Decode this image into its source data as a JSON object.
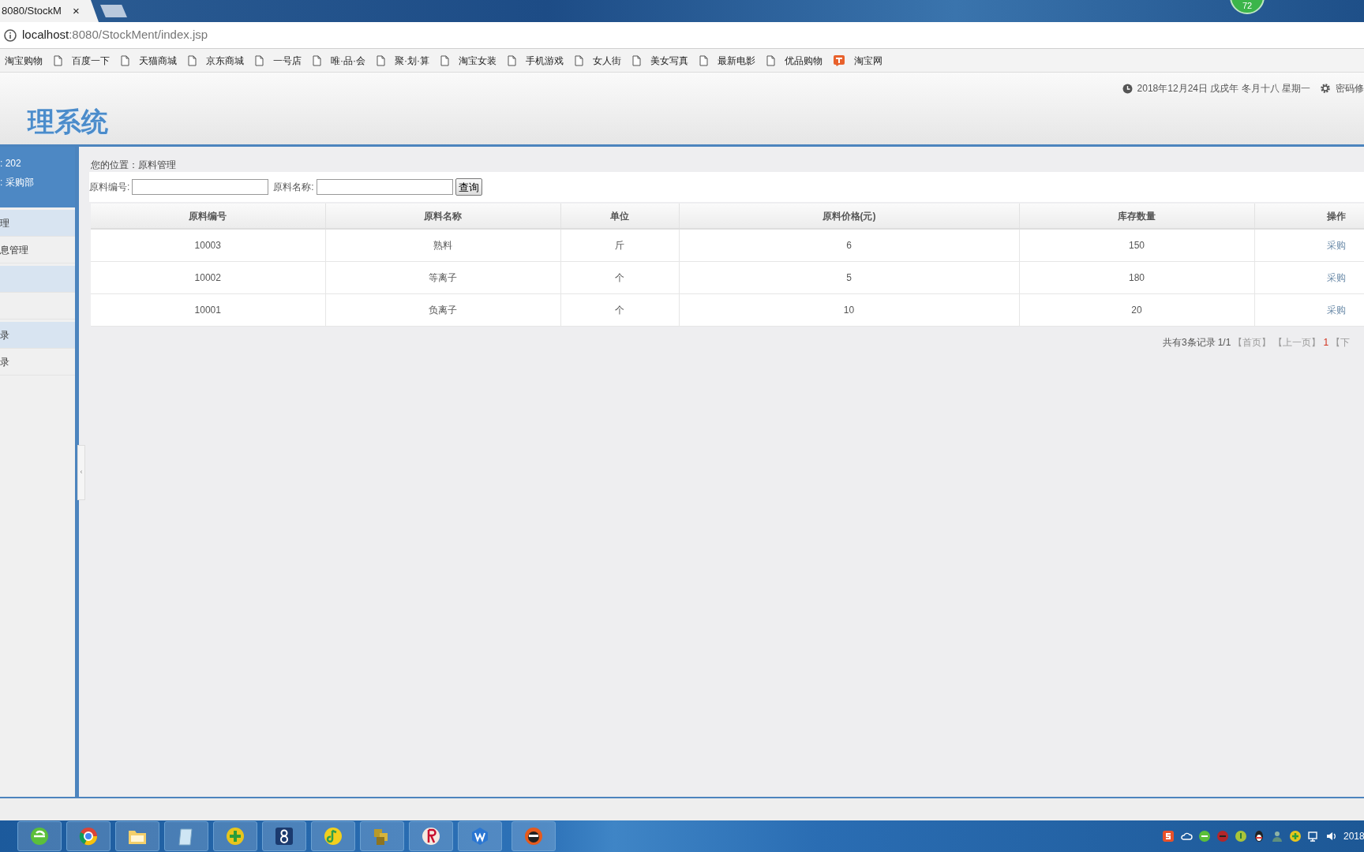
{
  "browser": {
    "tab_title": "8080/StockM",
    "tab_close": "×",
    "address": "localhost:8080/StockMent/index.jsp",
    "bookmarks": [
      {
        "label": "淘宝购物",
        "kind": "plain"
      },
      {
        "label": "百度一下",
        "kind": "page"
      },
      {
        "label": "天猫商城",
        "kind": "page"
      },
      {
        "label": "京东商城",
        "kind": "page"
      },
      {
        "label": "一号店",
        "kind": "page"
      },
      {
        "label": "唯·品·会",
        "kind": "page"
      },
      {
        "label": "聚·划·算",
        "kind": "page"
      },
      {
        "label": "淘宝女装",
        "kind": "page"
      },
      {
        "label": "手机游戏",
        "kind": "page"
      },
      {
        "label": "女人街",
        "kind": "page"
      },
      {
        "label": "美女写真",
        "kind": "page"
      },
      {
        "label": "最新电影",
        "kind": "page"
      },
      {
        "label": "优品购物",
        "kind": "page"
      },
      {
        "label": "淘宝网",
        "kind": "taobao"
      }
    ]
  },
  "desktop_badge": "72",
  "collapse_handle": "‹",
  "header": {
    "title": "理系统",
    "date": "2018年12月24日 戊戌年 冬月十八 星期一",
    "password_link": "密码修"
  },
  "user_info": [
    ": 202",
    ": 采购部"
  ],
  "sidebar": {
    "items": [
      {
        "label": "理",
        "kind": "group"
      },
      {
        "label": "息管理",
        "kind": "item"
      },
      {
        "kind": "group"
      },
      {
        "kind": "item"
      },
      {
        "label": "录",
        "kind": "group"
      },
      {
        "label": "录",
        "kind": "item"
      }
    ]
  },
  "breadcrumb": "您的位置：原料管理",
  "search": {
    "fields": [
      {
        "label": "原料编号:"
      },
      {
        "label": "原料名称:"
      }
    ],
    "button": "查询"
  },
  "table": {
    "columns": [
      "原料编号",
      "原料名称",
      "单位",
      "原料价格(元)",
      "库存数量",
      "操作"
    ],
    "rows": [
      [
        "10003",
        "熟料",
        "斤",
        "6",
        "150",
        "采购"
      ],
      [
        "10002",
        "等离子",
        "个",
        "5",
        "180",
        "采购"
      ],
      [
        "10001",
        "负离子",
        "个",
        "10",
        "20",
        "采购"
      ]
    ]
  },
  "pagination": {
    "summary": "共有3条记录",
    "pages": "1/1",
    "links": [
      {
        "label": "【首页】",
        "disabled": true,
        "selected": false
      },
      {
        "label": "【上一页】",
        "disabled": true,
        "selected": false
      },
      {
        "label": "1",
        "disabled": false,
        "selected": true
      },
      {
        "label": "【下",
        "disabled": true,
        "selected": false
      }
    ]
  },
  "clock": "2018"
}
